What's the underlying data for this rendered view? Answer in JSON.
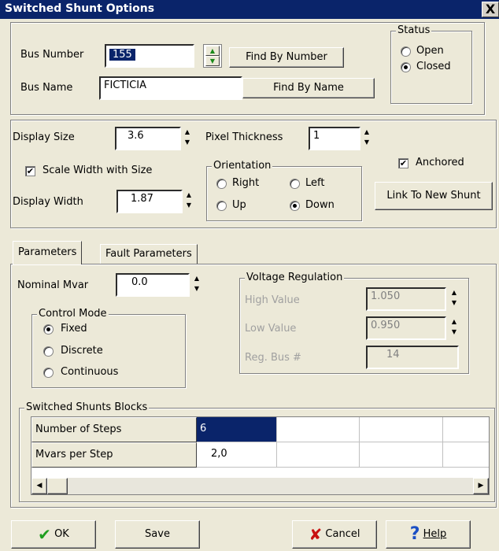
{
  "window": {
    "title": "Switched Shunt Options",
    "close_glyph": "X"
  },
  "bus": {
    "number_label": "Bus Number",
    "number_value": "155",
    "find_by_number": "Find By Number",
    "name_label": "Bus Name",
    "name_value": "FICTICIA",
    "find_by_name": "Find By Name"
  },
  "status": {
    "legend": "Status",
    "options": [
      "Open",
      "Closed"
    ],
    "selected": "Closed"
  },
  "display": {
    "size_label": "Display Size",
    "size_value": "3.6",
    "pixel_thickness_label": "Pixel Thickness",
    "pixel_thickness_value": "1",
    "scale_width_label": "Scale Width with Size",
    "scale_width_checked": true,
    "width_label": "Display Width",
    "width_value": "1.87",
    "anchored_label": "Anchored",
    "anchored_checked": true,
    "link_button": "Link To New Shunt"
  },
  "orientation": {
    "legend": "Orientation",
    "options": [
      "Right",
      "Left",
      "Up",
      "Down"
    ],
    "selected": "Down"
  },
  "tabs": {
    "items": [
      "Parameters",
      "Fault Parameters"
    ],
    "active": "Parameters"
  },
  "parameters": {
    "nominal_mvar_label": "Nominal Mvar",
    "nominal_mvar_value": "0.0",
    "control_mode": {
      "legend": "Control Mode",
      "options": [
        "Fixed",
        "Discrete",
        "Continuous"
      ],
      "selected": "Fixed"
    },
    "voltage_regulation": {
      "legend": "Voltage Regulation",
      "high_label": "High Value",
      "high_value": "1.050",
      "low_label": "Low Value",
      "low_value": "0.950",
      "reg_bus_label": "Reg. Bus #",
      "reg_bus_value": "14"
    }
  },
  "blocks": {
    "legend": "Switched Shunts Blocks",
    "rows": [
      {
        "header": "Number of Steps",
        "values": [
          "6",
          "",
          "",
          "",
          ""
        ]
      },
      {
        "header": "Mvars per Step",
        "values": [
          "2,0",
          "",
          "",
          "",
          ""
        ]
      }
    ]
  },
  "footer": {
    "ok": "OK",
    "save": "Save",
    "cancel": "Cancel",
    "help": "Help"
  },
  "colors": {
    "title_bar": "#0a246a",
    "selection": "#0a246a",
    "face": "#ece9d8",
    "ok_check": "#1f9e1f",
    "cancel_x": "#c81010",
    "help_q": "#1b4fc4"
  }
}
